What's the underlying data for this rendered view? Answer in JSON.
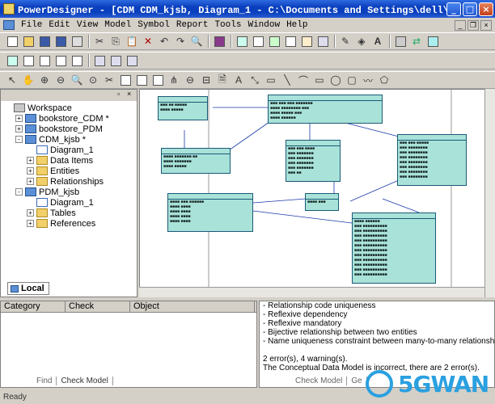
{
  "window": {
    "title": "PowerDesigner - [CDM CDM_kjsb, Diagram_1 - C:\\Documents and Settings\\dell\\桌面\\...",
    "minimize": "_",
    "maximize": "□",
    "close": "×"
  },
  "menu": [
    "File",
    "Edit",
    "View",
    "Model",
    "Symbol",
    "Report",
    "Tools",
    "Window",
    "Help"
  ],
  "browser": {
    "tab_label": "Local",
    "tree": [
      {
        "label": "Workspace",
        "level": 0,
        "icon": "workspace-icon",
        "exp": ""
      },
      {
        "label": "bookstore_CDM *",
        "level": 1,
        "icon": "model-icon",
        "exp": "+"
      },
      {
        "label": "bookstore_PDM",
        "level": 1,
        "icon": "model-icon",
        "exp": "+"
      },
      {
        "label": "CDM_kjsb *",
        "level": 1,
        "icon": "model-icon",
        "exp": "-"
      },
      {
        "label": "Diagram_1",
        "level": 2,
        "icon": "diagram-icon",
        "exp": ""
      },
      {
        "label": "Data Items",
        "level": 2,
        "icon": "folder-icon",
        "exp": "+"
      },
      {
        "label": "Entities",
        "level": 2,
        "icon": "folder-icon",
        "exp": "+"
      },
      {
        "label": "Relationships",
        "level": 2,
        "icon": "folder-icon",
        "exp": "+"
      },
      {
        "label": "PDM_kjsb",
        "level": 1,
        "icon": "model-icon",
        "exp": "-"
      },
      {
        "label": "Diagram_1",
        "level": 2,
        "icon": "diagram-icon",
        "exp": ""
      },
      {
        "label": "Tables",
        "level": 2,
        "icon": "folder-icon",
        "exp": "+"
      },
      {
        "label": "References",
        "level": 2,
        "icon": "folder-icon",
        "exp": "+"
      }
    ]
  },
  "result_list": {
    "columns": [
      "Category",
      "Check",
      "Object"
    ],
    "tabs": [
      "Find",
      "Check Model"
    ]
  },
  "output": {
    "lines": [
      "-   Relationship code uniqueness",
      "-   Reflexive dependency",
      "-   Reflexive mandatory",
      "-   Bijective relationship between two entities",
      "-   Name uniqueness constraint between many-to-many relationships a",
      "",
      "2 error(s),  4 warning(s).",
      "The Conceptual Data Model is incorrect, there are 2 error(s)."
    ],
    "tabs": [
      "Check Model",
      "Ge"
    ]
  },
  "status": "Ready",
  "watermark": "5GWAN"
}
